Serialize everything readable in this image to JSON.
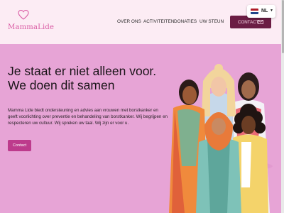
{
  "header": {
    "logo_text": "MammaLide",
    "nav": [
      "OVER ONS",
      "ACTIVITEITEN",
      "DONATIES",
      "UW STEUN"
    ],
    "cta_label": "CONTACT",
    "language": "NL"
  },
  "hero": {
    "title_line1": "Je staat er niet alleen voor.",
    "title_line2": "We doen dit samen",
    "body": "Mamma Lide biedt ondersteuning en advies aan vrouwen met borstkanker en geeft voorlichting over preventie en behandeling van borstkanker. Wij begrijpen en respecteren uw cultuur. Wij spreken uw taal. Wij zijn er voor u.",
    "button_label": "Contact"
  },
  "colors": {
    "header_bg": "#fcecf4",
    "hero_bg": "#e7a4d6",
    "brand_pink": "#d95aa3",
    "cta_bg": "#6b1d44",
    "button_bg": "#bd3b8c"
  },
  "icons": {
    "logo": "heart-icon",
    "cta": "mail-icon",
    "language": "netherlands-flag-icon"
  }
}
